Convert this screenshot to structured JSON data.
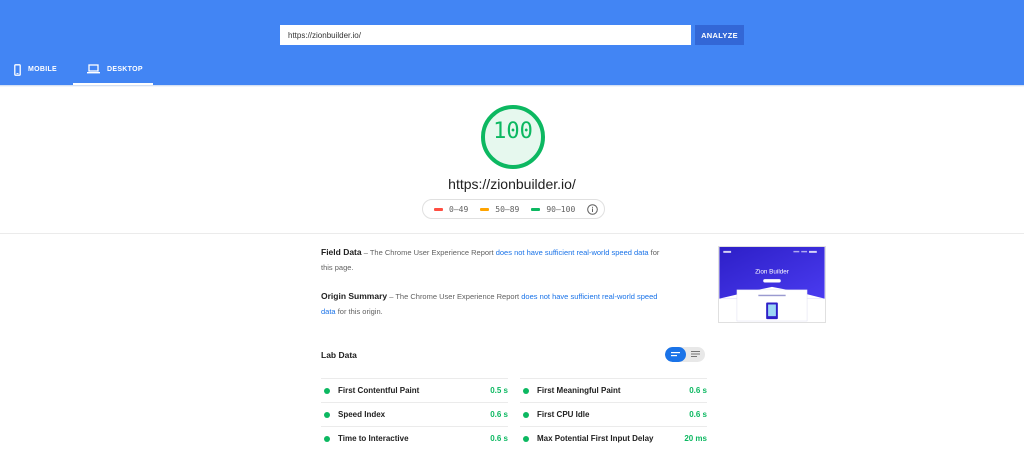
{
  "header": {
    "url_value": "https://zionbuilder.io/",
    "analyze_label": "ANALYZE",
    "tabs": [
      {
        "label": "MOBILE",
        "icon": "smartphone-icon",
        "active": false
      },
      {
        "label": "DESKTOP",
        "icon": "laptop-icon",
        "active": true
      }
    ],
    "color": "#4285f4"
  },
  "score": {
    "value": "100",
    "color": "#0cb861",
    "tested_url": "https://zionbuilder.io/"
  },
  "legend": {
    "items": [
      {
        "range": "0–49",
        "color": "#ff4e42"
      },
      {
        "range": "50–89",
        "color": "#ffa400"
      },
      {
        "range": "90–100",
        "color": "#0cb861"
      }
    ],
    "info_icon": "info-icon"
  },
  "field_data": {
    "heading": "Field Data",
    "text_before": " – The Chrome User Experience Report ",
    "link": "does not have sufficient real-world speed data",
    "text_after": " for this page."
  },
  "origin_summary": {
    "heading": "Origin Summary",
    "text_before": " – The Chrome User Experience Report ",
    "link": "does not have sufficient real-world speed data",
    "text_after": " for this origin."
  },
  "thumbnail": {
    "title": "Zion Builder"
  },
  "lab_data": {
    "title": "Lab Data",
    "metrics": [
      {
        "label": "First Contentful Paint",
        "value": "0.5 s"
      },
      {
        "label": "First Meaningful Paint",
        "value": "0.6 s"
      },
      {
        "label": "Speed Index",
        "value": "0.6 s"
      },
      {
        "label": "First CPU Idle",
        "value": "0.6 s"
      },
      {
        "label": "Time to Interactive",
        "value": "0.6 s"
      },
      {
        "label": "Max Potential First Input Delay",
        "value": "20 ms"
      }
    ]
  }
}
